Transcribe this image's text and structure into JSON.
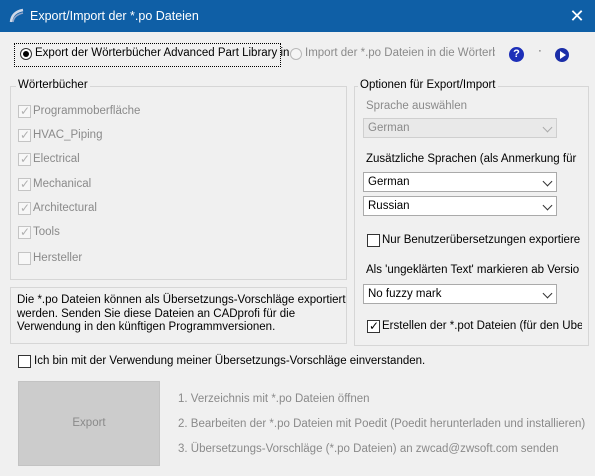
{
  "window": {
    "title": "Export/Import der *.po Dateien",
    "close_glyph": "✕",
    "titlebar_color": "#0f5fa6"
  },
  "mode": {
    "export_label": "Export der Wörterbücher Advanced Part Library in",
    "import_label": "Import der *.po Dateien in die Wörterbü",
    "help_glyph": "?",
    "dot_glyph": "·"
  },
  "dictionaries": {
    "title": "Wörterbücher",
    "items": [
      {
        "label": "Programmoberfläche",
        "checked": true
      },
      {
        "label": "HVAC_Piping",
        "checked": true
      },
      {
        "label": "Electrical",
        "checked": true
      },
      {
        "label": "Mechanical",
        "checked": true
      },
      {
        "label": "Architectural",
        "checked": true
      },
      {
        "label": "Tools",
        "checked": true
      },
      {
        "label": "Hersteller",
        "checked": false
      }
    ]
  },
  "info_text": "Die *.po Dateien können als Übersetzungs-Vorschläge exportiert werden. Senden Sie diese Dateien an CADprofi für die Verwendung in den künftigen Programmversionen.",
  "options": {
    "title": "Optionen für Export/Import",
    "language_label": "Sprache auswählen",
    "language_value": "German",
    "additional_label": "Zusätzliche Sprachen (als Anmerkung für",
    "additional_1": "German",
    "additional_2": "Russian",
    "only_user_label": "Nur Benutzerübersetzungen exportieren",
    "unresolved_label": "Als 'ungeklärten Text' markieren ab Version:",
    "fuzzy_value": "No fuzzy mark",
    "pot_label": "Erstellen der *.pot Dateien (für den Übers"
  },
  "consent_label": "Ich bin mit der Verwendung meiner Übersetzungs-Vorschläge einverstanden.",
  "export_button": "Export",
  "steps": [
    "1. Verzeichnis mit *.po Dateien öffnen",
    "2. Bearbeiten der *.po Dateien mit Poedit (Poedit herunterladen und installieren)",
    "3. Übersetzungs-Vorschläge (*.po Dateien) an zwcad@zwsoft.com senden"
  ]
}
